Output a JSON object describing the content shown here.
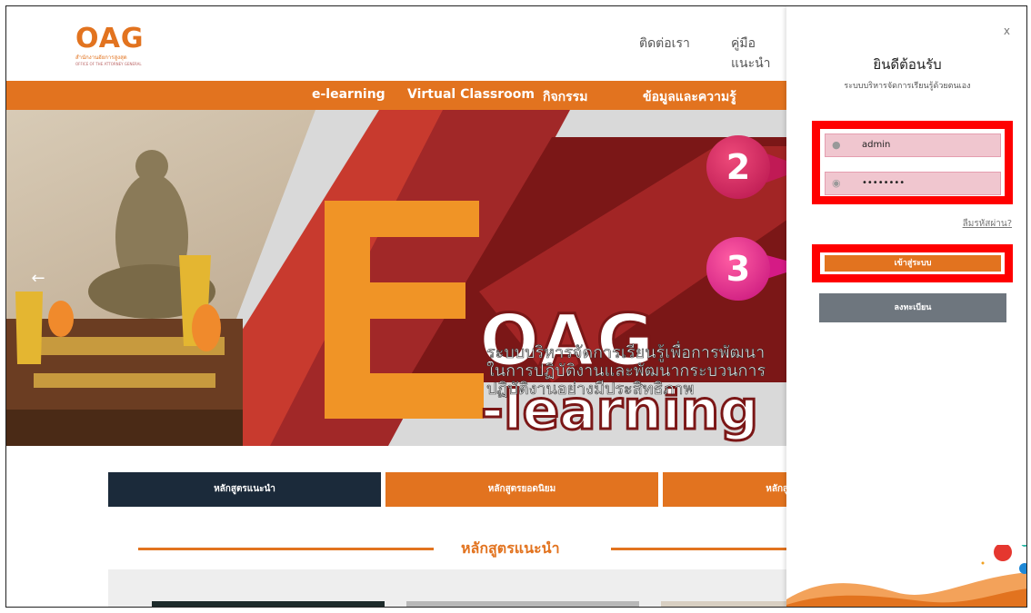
{
  "header": {
    "logo_text": "OAG",
    "logo_sub": "สำนักงานอัยการสูงสุด",
    "logo_sub_en": "OFFICE OF THE ATTORNEY GENERAL",
    "links": [
      "ติดต่อเรา",
      "คู่มือแนะนำ"
    ]
  },
  "nav": {
    "items": [
      "e-learning",
      "Virtual Classroom",
      "กิจกรรม",
      "ข้อมูลและความรู้"
    ]
  },
  "hero": {
    "oag": "OAG",
    "learning": "-learning",
    "subtitle_lines": [
      "ระบบบริหารจัดการเรียนรู้เพื่อการพัฒนา",
      "ในการปฏิบัติงานและพัฒนากระบวนการ",
      "ปฏิบัติงานอย่างมีประสิทธิภาพ"
    ]
  },
  "tabs": [
    "หลักสูตรแนะนำ",
    "หลักสูตรยอดนิยม",
    "หลักสูตร"
  ],
  "section": {
    "title": "หลักสูตรแนะนำ"
  },
  "login": {
    "close": "x",
    "welcome": "ยินดีต้อนรับ",
    "subtitle": "ระบบบริหารจัดการเรียนรู้ด้วยตนเอง",
    "username": "admin",
    "password": "••••••••",
    "forgot": "ลืมรหัสผ่าน?",
    "login_button": "เข้าสู่ระบบ",
    "register_button": "ลงทะเบียน"
  },
  "badges": {
    "step2": "2",
    "step3": "3"
  },
  "colors": {
    "orange": "#e2731f",
    "navy": "#1b2a3a",
    "red": "#ff0000",
    "gray_button": "#6e767e"
  }
}
